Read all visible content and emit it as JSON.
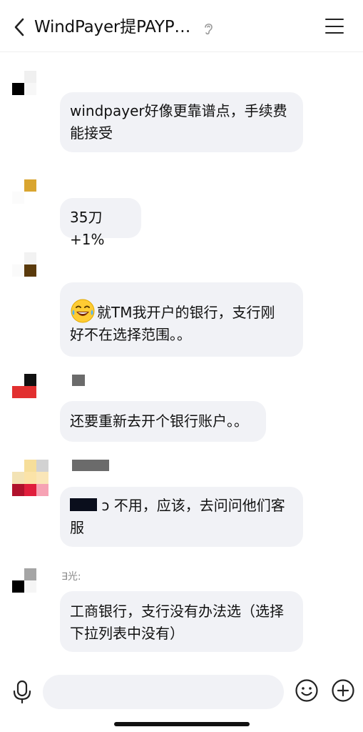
{
  "header": {
    "title": "WindPayer提PAYP…",
    "back_icon": "chevron-left-icon",
    "ear_icon": "ear-icon",
    "menu_icon": "menu-icon"
  },
  "messages": [
    {
      "sender": "",
      "text": "windpayer好像更靠谱点，手续费能接受",
      "lines": [
        "windpayer好像更靠谱点，手续费",
        "能接受"
      ]
    },
    {
      "sender": "",
      "text": "35刀+1%",
      "lines": [
        "35刀+1%"
      ]
    },
    {
      "sender": "",
      "emoji": "😂",
      "lines": [
        "就TM我开户的银行，支行刚",
        "好不在选择范围。。"
      ]
    },
    {
      "sender": "",
      "text": "还要重新去开个银行账户。。",
      "lines": [
        "还要重新去开个银行账户。。"
      ]
    },
    {
      "sender": "",
      "lines": [
        "ɔ 不用，应该，去问问他们客",
        "服"
      ]
    },
    {
      "sender": "∃光:",
      "lines": [
        "工商银行，支行没有办法选（选择",
        "下拉列表中没有）"
      ]
    }
  ],
  "bottom": {
    "mic_icon": "microphone-icon",
    "emoji_icon": "smile-icon",
    "plus_icon": "plus-circle-icon"
  },
  "colors": {
    "bubble": "#f1f2f6",
    "text": "#111111",
    "blur_block": "#6b6b6b"
  }
}
